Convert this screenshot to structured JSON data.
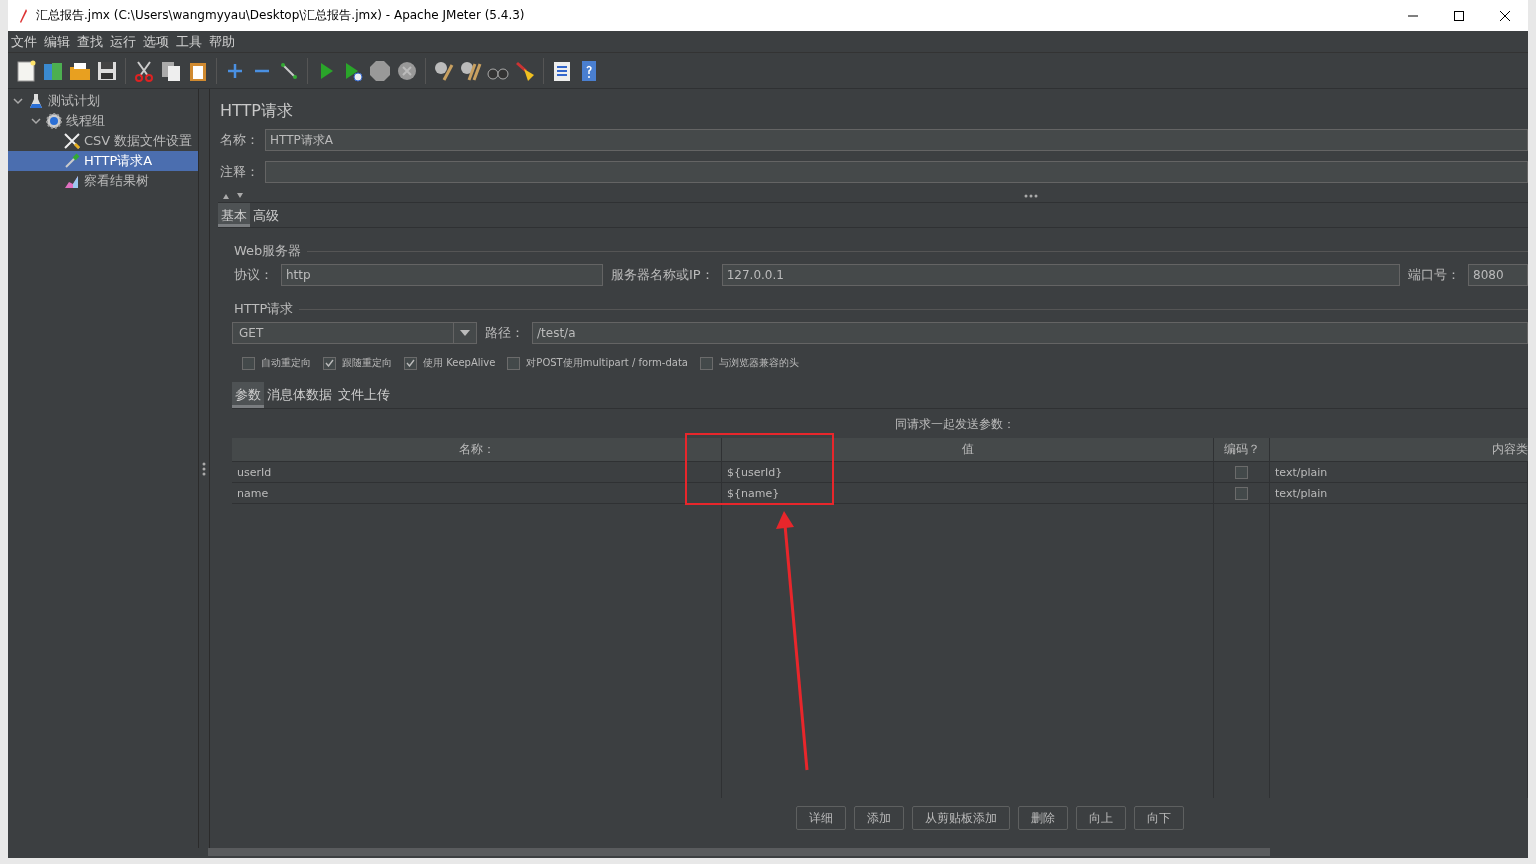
{
  "window": {
    "title": "汇总报告.jmx (C:\\Users\\wangmyyau\\Desktop\\汇总报告.jmx) - Apache JMeter (5.4.3)"
  },
  "menu": [
    "文件",
    "编辑",
    "查找",
    "运行",
    "选项",
    "工具",
    "帮助"
  ],
  "tree": [
    {
      "label": "测试计划",
      "kind": "plan",
      "expanded": true,
      "selected": false,
      "children": [
        {
          "label": "线程组",
          "kind": "threads",
          "expanded": true,
          "selected": false,
          "children": [
            {
              "label": "CSV 数据文件设置",
              "kind": "config",
              "selected": false
            },
            {
              "label": "HTTP请求A",
              "kind": "sampler",
              "selected": true
            },
            {
              "label": "察看结果树",
              "kind": "listener",
              "selected": false
            }
          ]
        }
      ]
    }
  ],
  "panel": {
    "title": "HTTP请求",
    "name": {
      "label": "名称：",
      "value": "HTTP请求A"
    },
    "comment": {
      "label": "注释："
    },
    "tabs": [
      {
        "label": "基本",
        "selected": true
      },
      {
        "label": "高级",
        "selected": false
      }
    ],
    "web_server": {
      "legend": "Web服务器",
      "protocol": {
        "label": "协议：",
        "value": "http"
      },
      "server": {
        "label": "服务器名称或IP：",
        "value": "127.0.0.1"
      },
      "port": {
        "label": "端口号：",
        "value": "8080"
      }
    },
    "http_request": {
      "legend": "HTTP请求",
      "method": "GET",
      "path": {
        "label": "路径：",
        "value": "/test/a"
      },
      "options": [
        {
          "label": "自动重定向",
          "checked": false
        },
        {
          "label": "跟随重定向",
          "checked": true
        },
        {
          "label": "使用 KeepAlive",
          "checked": true
        },
        {
          "label": "对POST使用multipart / form-data",
          "checked": false
        },
        {
          "label": "与浏览器兼容的头",
          "checked": false
        }
      ]
    },
    "sub_tabs": [
      {
        "label": "参数",
        "selected": true
      },
      {
        "label": "消息体数据",
        "selected": false
      },
      {
        "label": "文件上传",
        "selected": false
      }
    ],
    "params": {
      "caption": "同请求一起发送参数：",
      "columns": [
        "名称：",
        "值",
        "编码？",
        "内容类"
      ],
      "rows": [
        {
          "name": "userId",
          "value": "${userId}",
          "encode": false,
          "content_type": "text/plain"
        },
        {
          "name": "name",
          "value": "${name}",
          "encode": false,
          "content_type": "text/plain"
        }
      ]
    },
    "buttons": [
      "详细",
      "添加",
      "从剪贴板添加",
      "删除",
      "向上",
      "向下"
    ]
  },
  "annotations": [
    {
      "kind": "box"
    },
    {
      "kind": "arrow"
    }
  ]
}
